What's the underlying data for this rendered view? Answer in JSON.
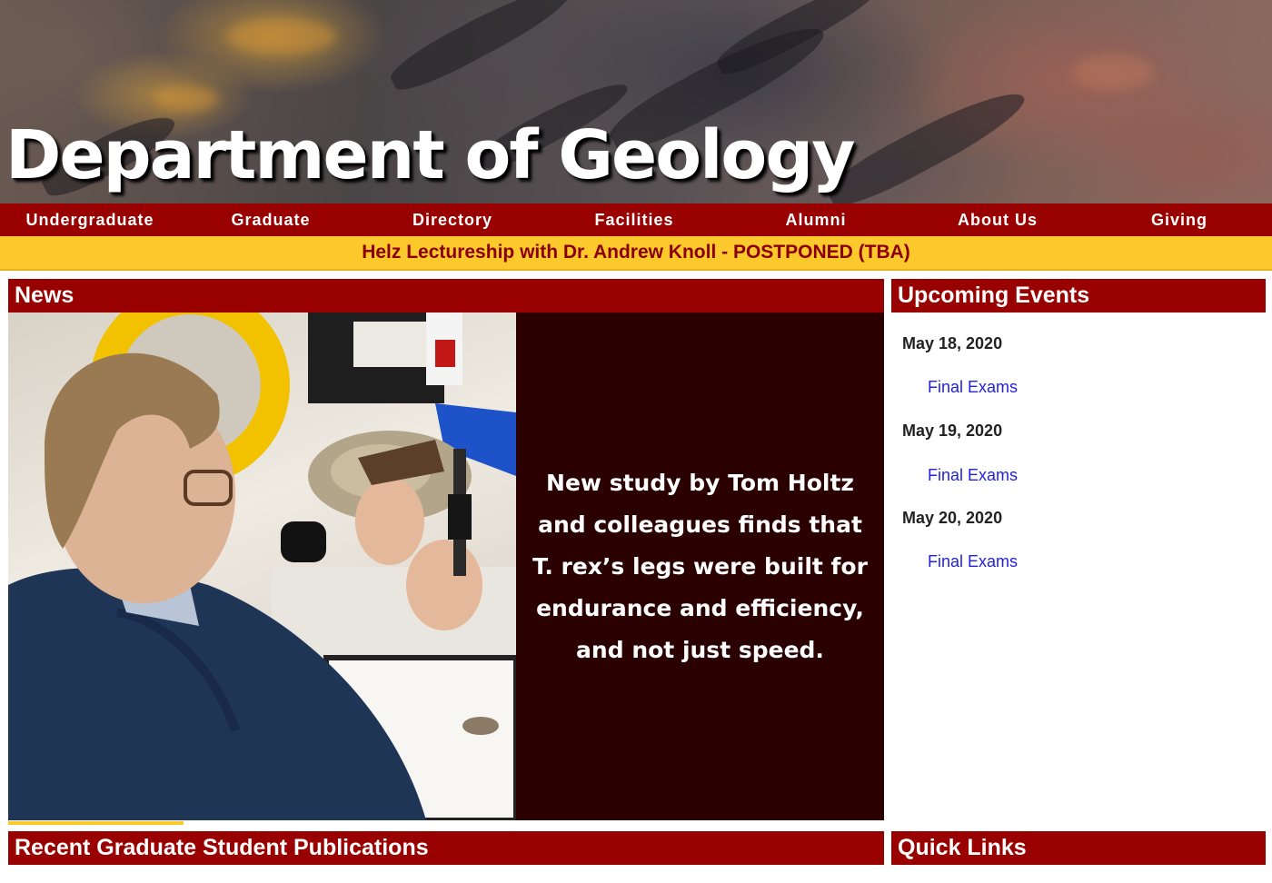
{
  "header": {
    "title": "Department of Geology"
  },
  "nav": {
    "items": [
      {
        "label": "Undergraduate"
      },
      {
        "label": "Graduate"
      },
      {
        "label": "Directory"
      },
      {
        "label": "Facilities"
      },
      {
        "label": "Alumni"
      },
      {
        "label": "About Us"
      },
      {
        "label": "Giving"
      }
    ]
  },
  "announcement": {
    "text": "Helz Lectureship with Dr. Andrew Knoll - POSTPONED (TBA)"
  },
  "news": {
    "heading": "News",
    "caption": "New study by Tom Holtz and colleagues finds that T. rex’s legs were built for endurance and efficiency, and not just speed.",
    "slide_progress": 0.2
  },
  "events": {
    "heading": "Upcoming Events",
    "items": [
      {
        "date": "May 18, 2020",
        "title": "Final Exams"
      },
      {
        "date": "May 19, 2020",
        "title": "Final Exams"
      },
      {
        "date": "May 20, 2020",
        "title": "Final Exams"
      }
    ]
  },
  "publications": {
    "heading": "Recent Graduate Student Publications"
  },
  "quick_links": {
    "heading": "Quick Links"
  },
  "colors": {
    "brand_red": "#990000",
    "brand_gold": "#fcc92c",
    "caption_bg": "#2a0000",
    "link_blue": "#2222dd"
  }
}
